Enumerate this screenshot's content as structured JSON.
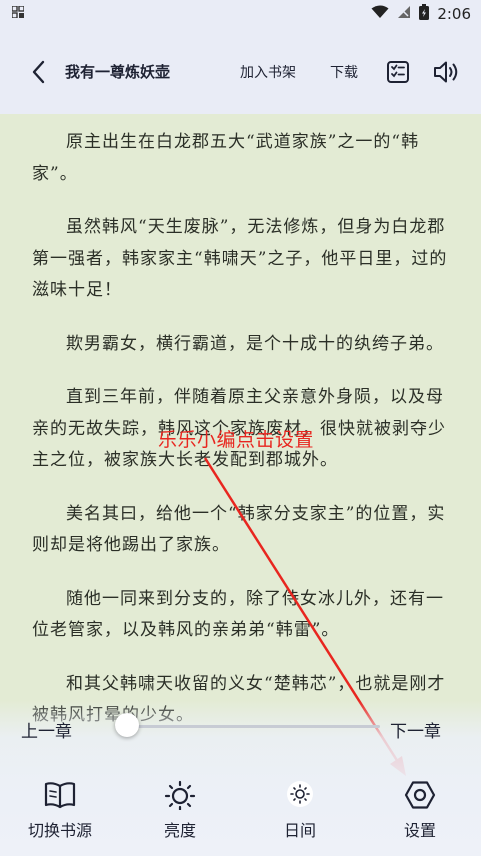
{
  "status_bar": {
    "time": "2:06",
    "icons": [
      "notification-grid-icon",
      "wifi-icon",
      "signal-icon",
      "battery-icon"
    ]
  },
  "app_bar": {
    "back_icon": "chevron-left-icon",
    "book_title": "我有一尊炼妖壶",
    "add_to_shelf": "加入书架",
    "download": "下载",
    "catalog_icon": "catalog-list-icon",
    "audio_icon": "speaker-icon"
  },
  "content": {
    "paragraphs": [
      "原主出生在白龙郡五大“武道家族”之一的“韩家”。",
      "虽然韩风“天生废脉”，无法修炼，但身为白龙郡第一强者，韩家家主“韩啸天”之子，他平日里，过的滋味十足！",
      "欺男霸女，横行霸道，是个十成十的纨绔子弟。",
      "直到三年前，伴随着原主父亲意外身陨，以及母亲的无故失踪，韩风这个家族废材，很快就被剥夺少主之位，被家族大长老发配到郡城外。",
      "美名其曰，给他一个“韩家分支家主”的位置，实则却是将他踢出了家族。",
      "随他一同来到分支的，除了侍女冰儿外，还有一位老管家，以及韩风的亲弟弟“韩雷”。",
      "和其父韩啸天收留的义女“楚韩芯”，也就是刚才被韩风打晕的少女。"
    ]
  },
  "annotation": {
    "text": "乐乐小编点击设置",
    "color": "#e8261f"
  },
  "chapter_nav": {
    "prev": "上一章",
    "next": "下一章",
    "progress": 0.0
  },
  "toolbar": {
    "switch_source": {
      "label": "切换书源",
      "icon": "open-book-icon"
    },
    "brightness": {
      "label": "亮度",
      "icon": "sun-icon"
    },
    "day_mode": {
      "label": "日间",
      "icon": "day-mode-icon"
    },
    "settings": {
      "label": "设置",
      "icon": "hexagon-gear-icon"
    }
  },
  "colors": {
    "reading_bg": "#e3ebd4",
    "header_bg": "#e9ecf6",
    "text": "#2b2f27",
    "accent_annotation": "#e8261f"
  }
}
